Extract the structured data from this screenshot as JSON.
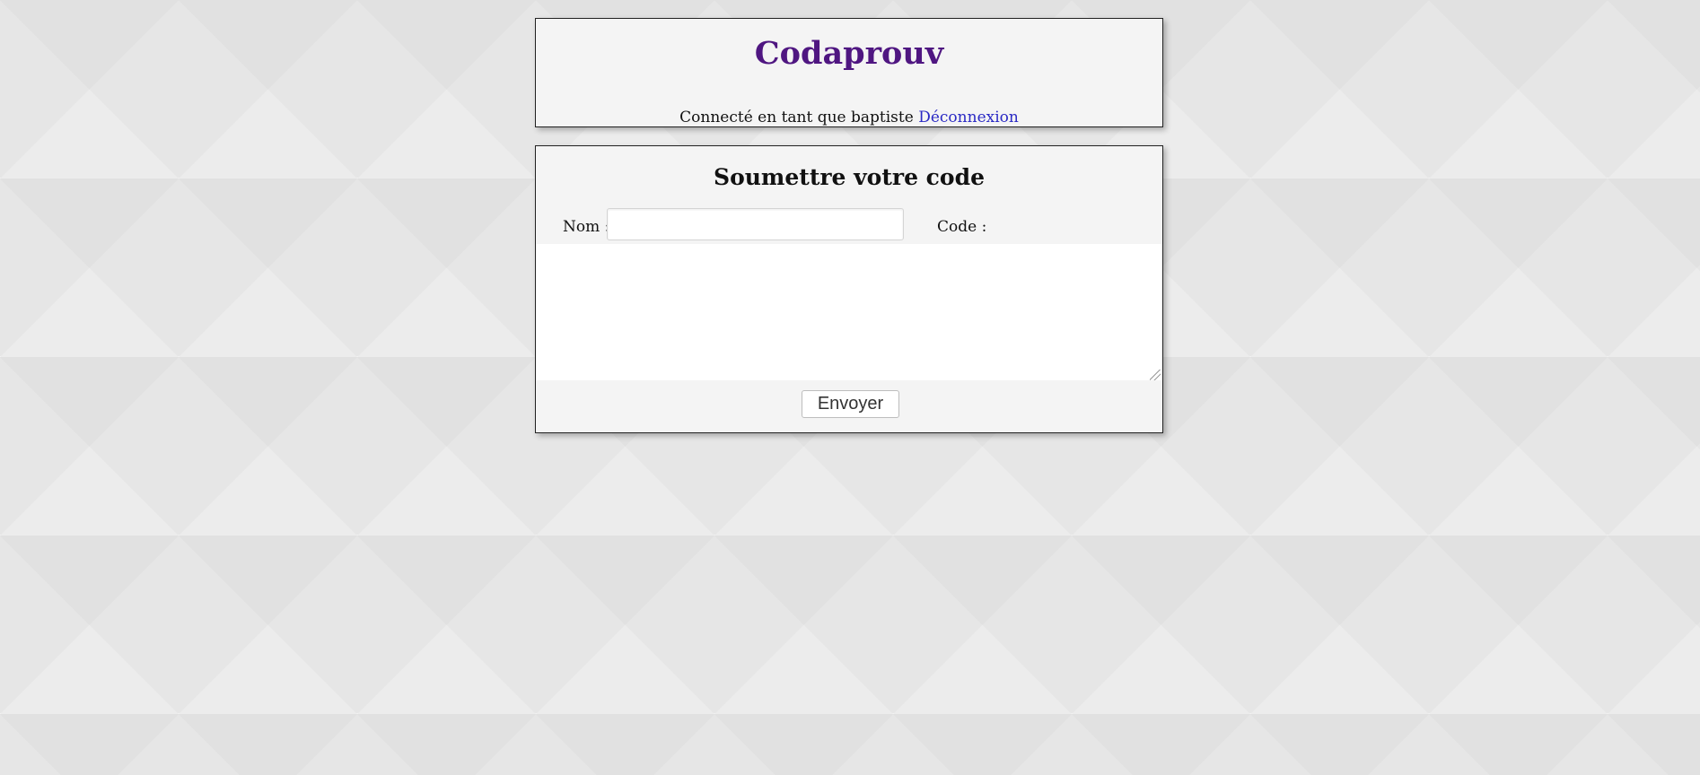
{
  "header": {
    "title": "Codaprouv",
    "login_prefix": "Connecté en tant que baptiste",
    "logout_link": "Déconnexion"
  },
  "form": {
    "title": "Soumettre votre code",
    "name_label": "Nom :",
    "name_value": "",
    "code_label": "Code :",
    "code_value": "",
    "submit_label": "Envoyer"
  },
  "colors": {
    "title": "#4f1681",
    "link": "#2a29c4",
    "panel_background": "#f4f4f4",
    "page_background": "#ececec"
  }
}
